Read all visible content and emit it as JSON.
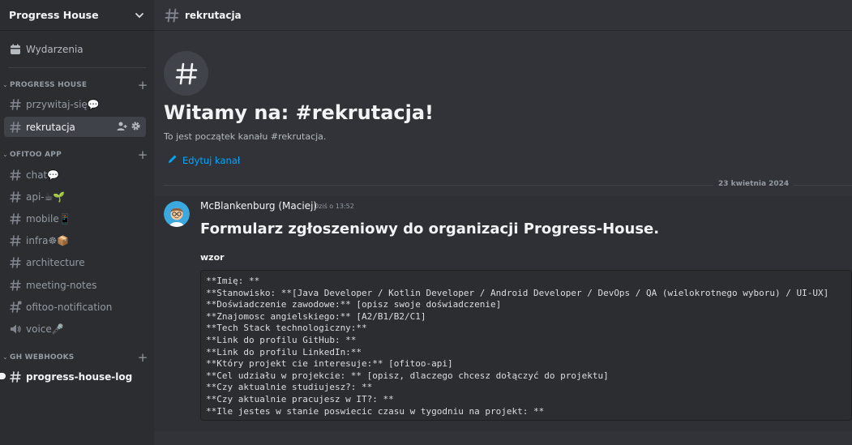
{
  "server": {
    "name": "Progress House"
  },
  "sidebar": {
    "events_label": "Wydarzenia",
    "categories": [
      {
        "label": "PROGRESS HOUSE",
        "channels": [
          {
            "label": "przywitaj-się💬",
            "icon": "hashtag-icon"
          },
          {
            "label": "rekrutacja",
            "icon": "hashtag-icon",
            "active": true
          }
        ]
      },
      {
        "label": "OFITOO APP",
        "channels": [
          {
            "label": "chat💬",
            "icon": "hashtag-icon"
          },
          {
            "label": "api-☕🌱",
            "icon": "hashtag-icon"
          },
          {
            "label": "mobile📱",
            "icon": "hashtag-icon"
          },
          {
            "label": "infra☸📦",
            "icon": "hashtag-icon"
          },
          {
            "label": "architecture",
            "icon": "hashtag-icon"
          },
          {
            "label": "meeting-notes",
            "icon": "hashtag-icon"
          },
          {
            "label": "ofitoo-notification",
            "icon": "hashtag-lock-icon"
          },
          {
            "label": "voice🎤",
            "icon": "speaker-icon"
          }
        ]
      },
      {
        "label": "GH WEBHOOKS",
        "channels": [
          {
            "label": "progress-house-log",
            "icon": "hashtag-icon",
            "unread": true
          }
        ]
      }
    ]
  },
  "topbar": {
    "channel": "rekrutacja"
  },
  "welcome": {
    "title": "Witamy na: #rekrutacja!",
    "subtitle": "To jest początek kanału #rekrutacja.",
    "edit_label": "Edytuj kanał"
  },
  "date_divider": "23 kwietnia 2024",
  "message": {
    "author": "McBlankenburg (Maciej)",
    "timestamp": "Dziś o 13:52",
    "heading": "Formularz zgłoszeniowy do organizacji Progress-House.",
    "subheading": "wzor",
    "code_lines": [
      "**Imię: **",
      "**Stanowisko: **[Java Developer / Kotlin Developer / Android Developer / DevOps / QA (wielokrotnego wyboru) / UI-UX]",
      "**Doświadczenie zawodowe:** [opisz swoje doświadczenie]",
      "**Znajomosc angielskiego:** [A2/B1/B2/C1]",
      "**Tech Stack technologiczny:**",
      "**Link do profilu GitHub: **",
      "**Link do profilu LinkedIn:**",
      "**Który projekt cie interesuje:** [ofitoo-api]",
      "**Cel udziału w projekcie: ** [opisz, dlaczego chcesz dołączyć do projektu]",
      "**Czy aktualnie studiujesz?: **",
      "**Czy aktualnie pracujesz w IT?: **",
      "**Ile jestes w stanie poswiecic czasu w tygodniu na projekt: **"
    ]
  },
  "colors": {
    "accent_link": "#00a8fc",
    "sidebar_bg": "#2b2d31",
    "main_bg": "#313338"
  }
}
